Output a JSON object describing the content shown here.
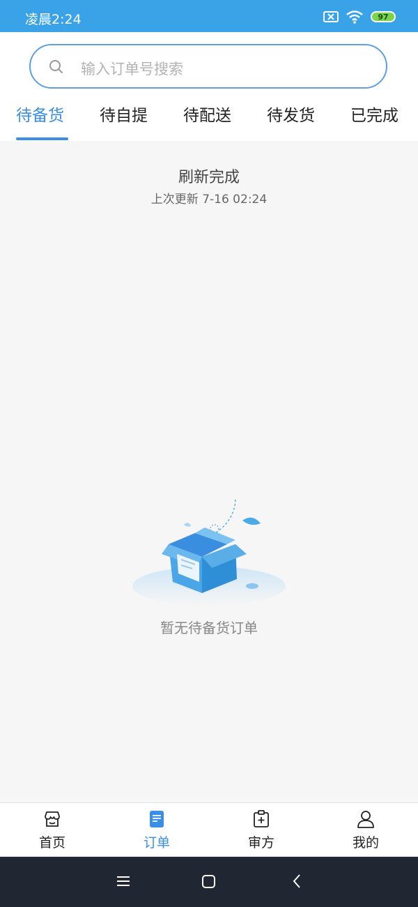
{
  "status_bar": {
    "time": "凌晨2:24",
    "battery": "97"
  },
  "search": {
    "placeholder": "输入订单号搜索"
  },
  "tabs": [
    {
      "label": "待备货",
      "active": true
    },
    {
      "label": "待自提",
      "active": false
    },
    {
      "label": "待配送",
      "active": false
    },
    {
      "label": "待发货",
      "active": false
    },
    {
      "label": "已完成",
      "active": false
    }
  ],
  "refresh": {
    "title": "刷新完成",
    "subtitle": "上次更新 7-16 02:24"
  },
  "empty_state": {
    "text": "暂无待备货订单"
  },
  "tabbar": {
    "items": [
      {
        "label": "首页",
        "icon": "store-icon",
        "active": false
      },
      {
        "label": "订单",
        "icon": "order-icon",
        "active": true
      },
      {
        "label": "审方",
        "icon": "prescription-icon",
        "active": false
      },
      {
        "label": "我的",
        "icon": "user-icon",
        "active": false
      }
    ]
  },
  "colors": {
    "accent": "#3a8ee6",
    "status_bar": "#3aa3e7",
    "nav_bar": "#202732"
  }
}
